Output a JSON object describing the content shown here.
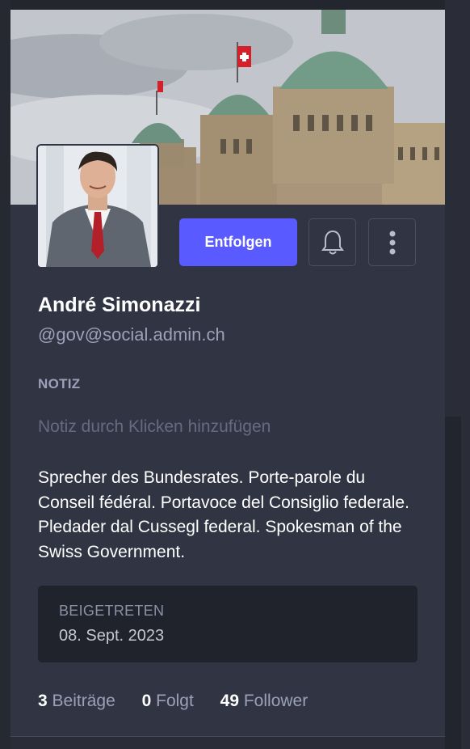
{
  "profile": {
    "header_image": "federal-palace-banner",
    "avatar": "profile-photo",
    "display_name": "André Simonazzi",
    "handle": "@gov@social.admin.ch",
    "bio": "Sprecher des Bundesrates. Porte-parole du Conseil fédéral. Portavoce del Consiglio federale. Pledader dal Cussegl federal. Spokesman of the Swiss Government."
  },
  "actions": {
    "unfollow_label": "Entfolgen",
    "notify_icon": "bell-icon",
    "more_icon": "more-vertical-icon"
  },
  "note": {
    "label": "NOTIZ",
    "placeholder": "Notiz durch Klicken hinzufügen"
  },
  "joined": {
    "label": "BEIGETRETEN",
    "date": "08. Sept. 2023"
  },
  "stats": [
    {
      "value": "3",
      "label": "Beiträge"
    },
    {
      "value": "0",
      "label": "Folgt"
    },
    {
      "value": "49",
      "label": "Follower"
    }
  ],
  "colors": {
    "accent": "#595aff",
    "background": "#313543",
    "text": "#ffffff",
    "muted": "#9aa1b8"
  }
}
